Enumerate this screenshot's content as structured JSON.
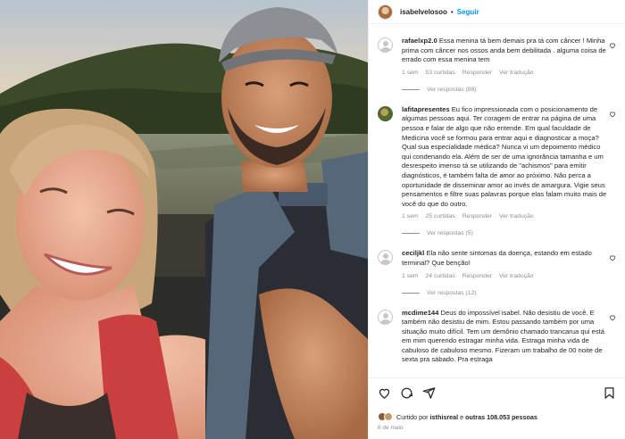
{
  "post": {
    "username": "isabelvelosoo",
    "separator": "•",
    "follow_label": "Seguir"
  },
  "comments": [
    {
      "username": "rafaelxp2.0",
      "avatar": "default-avatar",
      "text": "Essa menina tá bem demais pra tá com câncer ! Minha prima com câncer nos ossos anda bem debilitada . alguma coisa de errado com essa menina tem",
      "time": "1 sem",
      "likes": "53 curtidas",
      "reply_label": "Responder",
      "translate_label": "Ver tradução",
      "replies_label": "Ver respostas (88)"
    },
    {
      "username": "lafitapresentes",
      "avatar": "photo-avatar",
      "text": "Eu fico impressionada com o posicionamento de algumas pessoas aqui. Ter coragem de entrar na página de uma pessoa e falar de algo que não entende. Em qual faculdade de Medicina você se formou para entrar aqui e diagnosticar a moça? Qual sua especialidade médica? Nunca vi um depoimento médico qui condenando ela. Além de ser de uma ignorância tamanha e um desrespeito imenso tá se utilizando de \"achismos\" para emitir diagnósticos, é também falta de amor ao próximo. Não perca a oportunidade de disseminar amor ao invés de amargura. Vigie seus pensamentos e filtre suas palavras porque elas falam muito mais de você do que do outro.",
      "time": "1 sem",
      "likes": "25 curtidas",
      "reply_label": "Responder",
      "translate_label": "Ver tradução",
      "replies_label": "Ver respostas (5)"
    },
    {
      "username": "ceciljkl",
      "avatar": "default-avatar",
      "text": "Ela não sente sintomas da doença, estando em estado terminal? Que benção!",
      "time": "1 sem",
      "likes": "24 curtidas",
      "reply_label": "Responder",
      "translate_label": "Ver tradução",
      "replies_label": "Ver respostas (12)"
    },
    {
      "username": "mcdime144",
      "avatar": "default-avatar",
      "text": "Deus do impossível isabel. Não desistiu de você. E também não desistiu de mim. Estou passando também por uma situação muito difícil. Tem um demônio chamado trancarua qui está em mim querendo estragar minha vida. Estraga minha vida de cabuloso de cabuloso mesmo. Fizeram um trabalho de 00 noite de sexta pra sábado. Pra estraga",
      "time": "",
      "likes": "",
      "reply_label": "",
      "translate_label": "",
      "replies_label": ""
    }
  ],
  "footer": {
    "liked_prefix": "Curtido por",
    "liked_user": "isthisreal",
    "liked_mid": "e",
    "liked_others": "outras 108.053 pessoas",
    "date": "8 de maio"
  },
  "icons": {
    "like": "heart-icon",
    "comment": "comment-icon",
    "share": "share-icon",
    "save": "bookmark-icon"
  },
  "colors": {
    "link": "#0095f6",
    "muted": "#8e8e8e",
    "text": "#262626"
  }
}
